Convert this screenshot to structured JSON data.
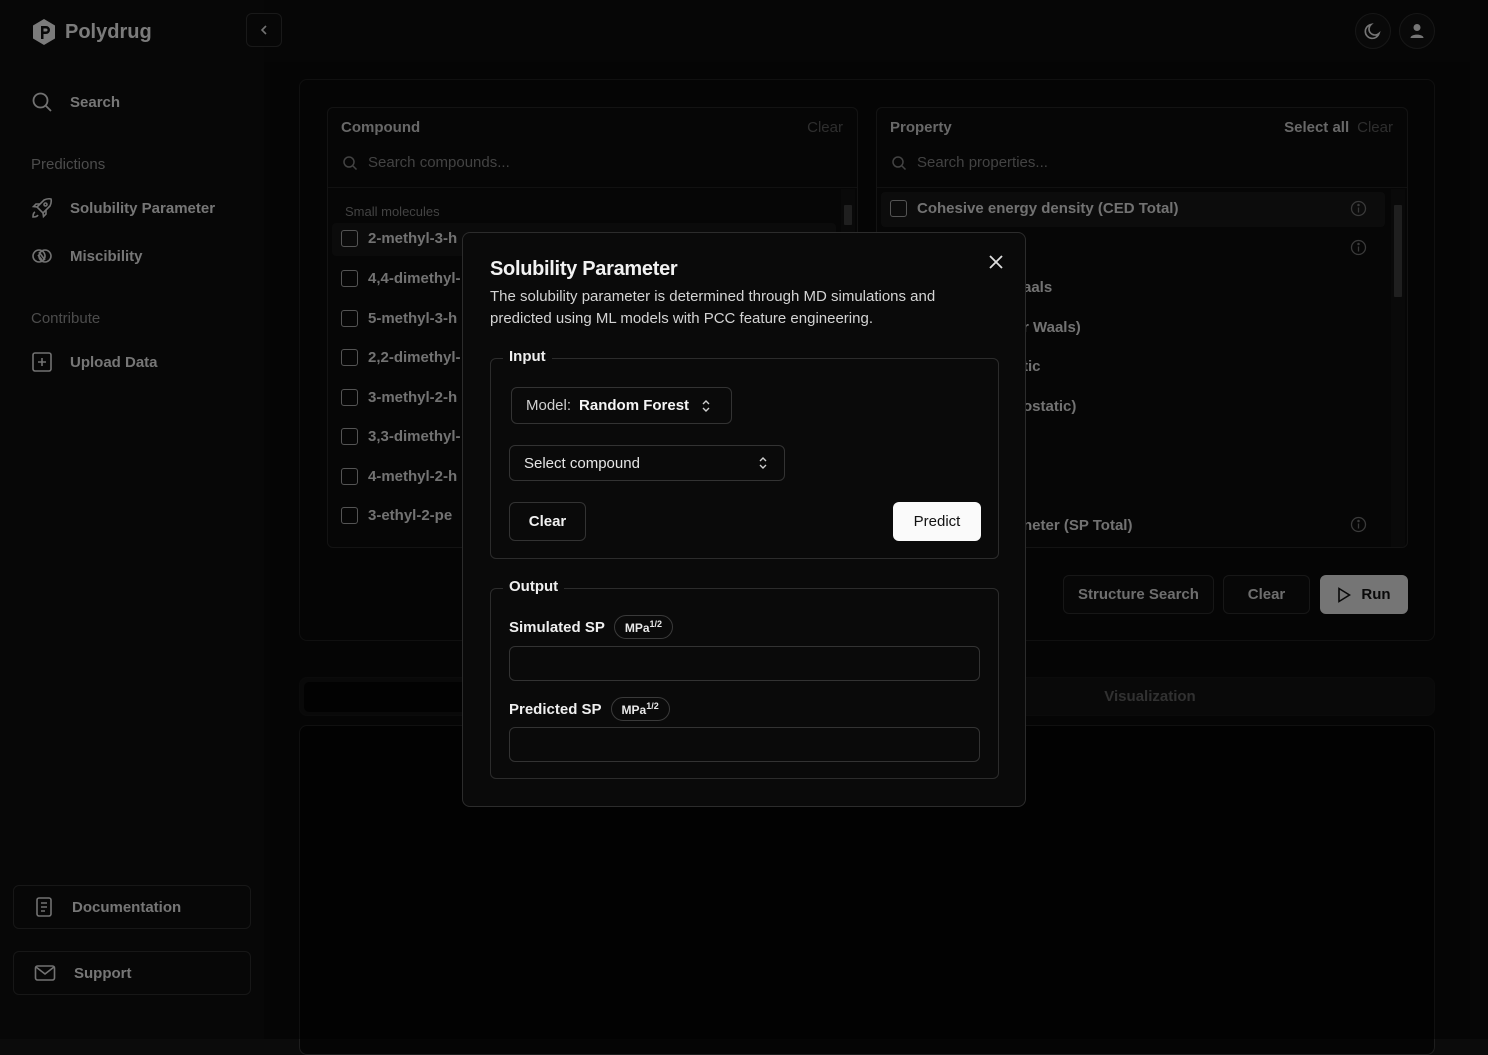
{
  "app": {
    "name": "Polydrug"
  },
  "sidebar": {
    "search_label": "Search",
    "predictions_section": "Predictions",
    "items": [
      {
        "label": "Solubility Parameter",
        "icon": "rocket-icon"
      },
      {
        "label": "Miscibility",
        "icon": "miscibility-icon"
      }
    ],
    "contribute_section": "Contribute",
    "upload_label": "Upload Data",
    "documentation_label": "Documentation",
    "support_label": "Support"
  },
  "compound_panel": {
    "title": "Compound",
    "clear_label": "Clear",
    "search_placeholder": "Search compounds...",
    "group_label": "Small molecules",
    "rows": [
      "2-methyl-3-h",
      "4,4-dimethyl-",
      "5-methyl-3-h",
      "2,2-dimethyl-",
      "3-methyl-2-h",
      "3,3-dimethyl-",
      "4-methyl-2-h",
      "3-ethyl-2-pe"
    ]
  },
  "property_panel": {
    "title": "Property",
    "select_all_label": "Select all",
    "clear_label": "Clear",
    "search_placeholder": "Search properties...",
    "rows": [
      "Cohesive energy density (CED Total)",
      "",
      "aals",
      "r Waals)",
      "tic",
      "ostatic)",
      "",
      "",
      "neter (SP Total)"
    ]
  },
  "actions": {
    "structure_search_label": "Structure Search",
    "clear_label": "Clear",
    "run_label": "Run"
  },
  "tabs": {
    "visualization_label": "Visualization"
  },
  "modal": {
    "title": "Solubility Parameter",
    "description": "The solubility parameter is determined through MD simulations and predicted using ML models with PCC feature engineering.",
    "input_legend": "Input",
    "model_label": "Model:",
    "model_value": "Random Forest",
    "compound_select_placeholder": "Select compound",
    "clear_label": "Clear",
    "predict_label": "Predict",
    "output_legend": "Output",
    "simulated_label": "Simulated SP",
    "predicted_label": "Predicted SP",
    "unit_base": "MPa",
    "unit_exp": "1/2",
    "simulated_value": "",
    "predicted_value": ""
  },
  "colors": {
    "background": "#0b0b0b",
    "accent": "#fafafa",
    "muted": "#7a7a7a"
  }
}
